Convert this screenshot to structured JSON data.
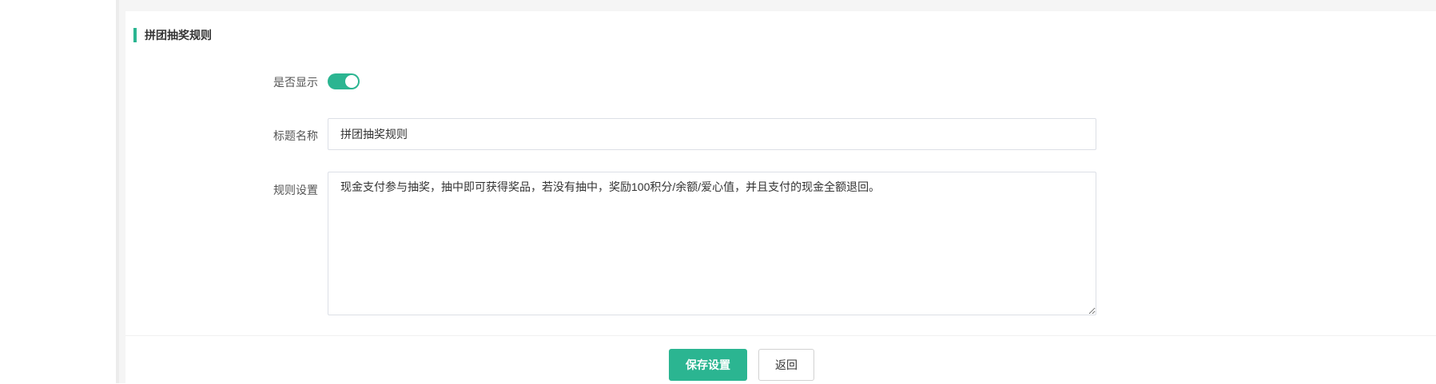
{
  "section": {
    "title": "拼团抽奖规则"
  },
  "form": {
    "show": {
      "label": "是否显示",
      "enabled": true
    },
    "title_field": {
      "label": "标题名称",
      "value": "拼团抽奖规则"
    },
    "rules_field": {
      "label": "规则设置",
      "value": "现金支付参与抽奖，抽中即可获得奖品，若没有抽中，奖励100积分/余额/爱心值，并且支付的现金全额退回。"
    }
  },
  "actions": {
    "save_label": "保存设置",
    "back_label": "返回"
  },
  "colors": {
    "accent": "#2bb591"
  }
}
